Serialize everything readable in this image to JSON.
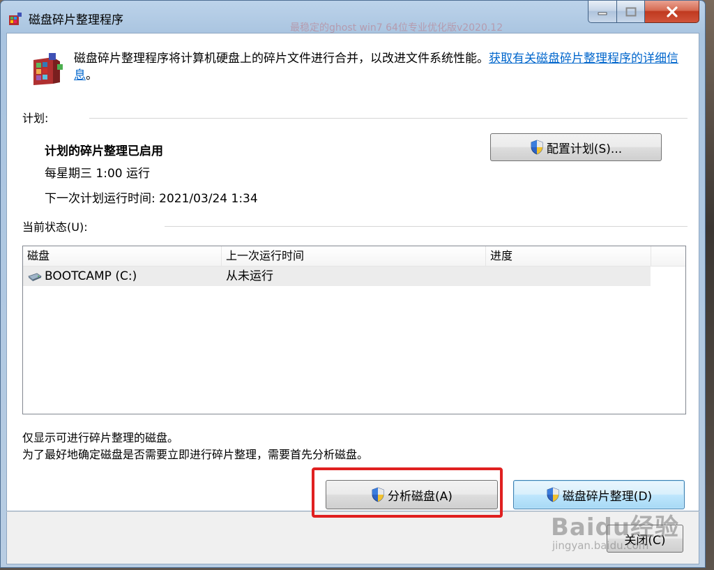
{
  "window": {
    "title": "磁盘碎片整理程序",
    "background_title_overlay": "最稳定的ghost win7 64位专业优化版v2020.12"
  },
  "intro": {
    "text": "磁盘碎片整理程序将计算机硬盘上的碎片文件进行合并，以改进文件系统性能。",
    "link": "获取有关磁盘碎片整理程序的详细信息",
    "tail": "。"
  },
  "schedule": {
    "label": "计划:",
    "status": "计划的碎片整理已启用",
    "frequency": "每星期三  1:00 运行",
    "next_run": "下一次计划运行时间: 2021/03/24 1:34",
    "configure_button": "配置计划(S)..."
  },
  "current_status": {
    "label": "当前状态(U):",
    "columns": [
      "磁盘",
      "上一次运行时间",
      "进度"
    ],
    "rows": [
      {
        "disk": "BOOTCAMP (C:)",
        "last_run": "从未运行",
        "progress": ""
      }
    ]
  },
  "notes": {
    "line1": "仅显示可进行碎片整理的磁盘。",
    "line2": "为了最好地确定磁盘是否需要立即进行碎片整理，需要首先分析磁盘。"
  },
  "actions": {
    "analyze_button": "分析磁盘(A)",
    "defrag_button": "磁盘碎片整理(D)",
    "close_button": "关闭(C)"
  },
  "watermark": {
    "main": "Baidu经验",
    "sub": "jingyan.baidu.com"
  },
  "colors": {
    "highlight": "#e02020",
    "link": "#0066cc",
    "selected_row": "#ececec"
  }
}
